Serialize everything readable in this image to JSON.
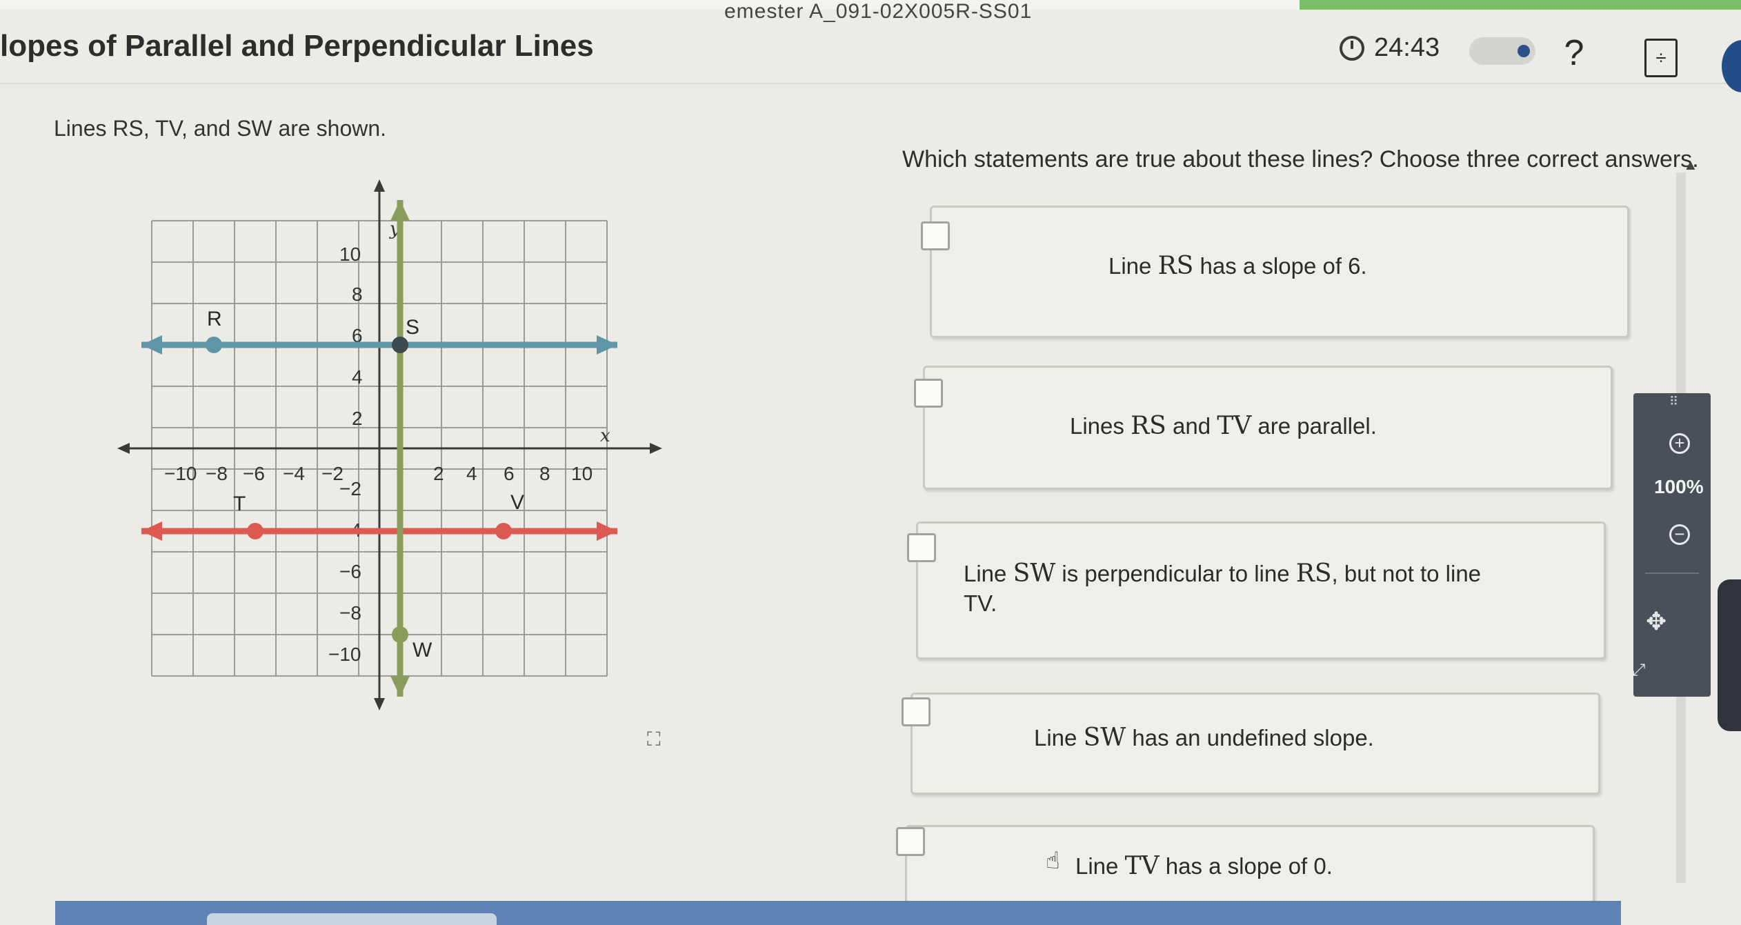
{
  "header": {
    "course_code": "emester A_091-02X005R-SS01",
    "lesson_title": "lopes of Parallel and Perpendicular Lines",
    "timer": "24:43"
  },
  "question": {
    "given_text": "Lines RS, TV, and SW are shown.",
    "prompt": "Which statements are true about these lines? Choose three correct answers."
  },
  "graph": {
    "x_label": "x",
    "y_label": "y",
    "x_ticks": [
      "−10",
      "−8",
      "−6",
      "−4",
      "−2",
      "2",
      "4",
      "6",
      "8",
      "10"
    ],
    "y_ticks_pos": [
      "10",
      "8",
      "6",
      "4",
      "2"
    ],
    "y_ticks_neg": [
      "−2",
      "−4",
      "−6",
      "−8",
      "−10"
    ],
    "points": {
      "R": {
        "label": "R",
        "x": -8,
        "y": 5
      },
      "S": {
        "label": "S",
        "x": 1,
        "y": 5
      },
      "T": {
        "label": "T",
        "x": -6,
        "y": -4
      },
      "V": {
        "label": "V",
        "x": 6,
        "y": -4
      },
      "W": {
        "label": "W",
        "x": 1,
        "y": -9
      }
    },
    "colors": {
      "RS": "#5e97a6",
      "TV": "#dd5a52",
      "SW": "#8a9c5c"
    }
  },
  "options": [
    {
      "pre": "Line ",
      "math": "RS",
      "post": " has a slope of 6.",
      "math2": "",
      "post2": ""
    },
    {
      "pre": "Lines ",
      "math": "RS",
      "post": " and ",
      "math2": "TV",
      "post2": " are parallel."
    },
    {
      "pre": "Line ",
      "math": "SW",
      "post": " is perpendicular to line ",
      "math2": "RS",
      "post2": ", but not to line TV."
    },
    {
      "pre": "Line ",
      "math": "SW",
      "post": " has an undefined slope.",
      "math2": "",
      "post2": ""
    },
    {
      "pre": "Line ",
      "math": "TV",
      "post": " has a slope of 0.",
      "math2": "",
      "post2": ""
    }
  ],
  "zoom": {
    "level": "100%"
  },
  "colors": {
    "bottom_bar": "#5d82b4",
    "top_strip": "#79c068"
  }
}
